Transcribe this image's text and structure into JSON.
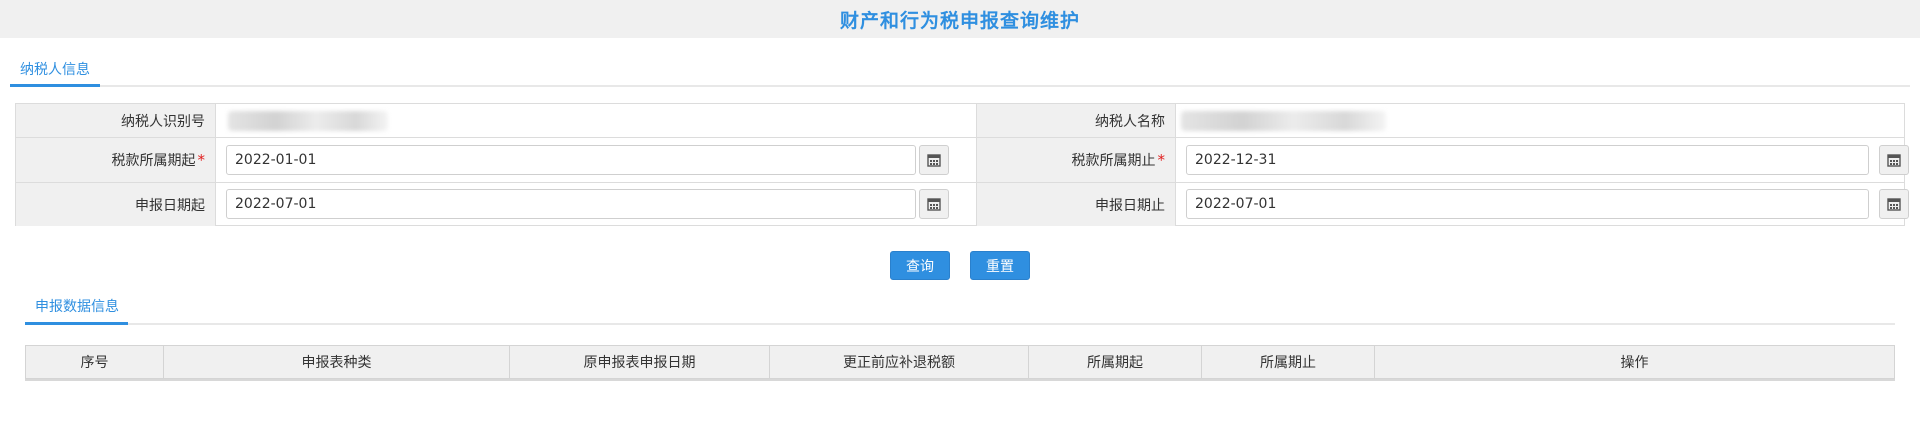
{
  "page": {
    "title": "财产和行为税申报查询维护"
  },
  "taxpayer_section": {
    "tab_label": "纳税人信息"
  },
  "form": {
    "taxpayer_id_label": "纳税人识别号",
    "taxpayer_name_label": "纳税人名称",
    "period_start_label": "税款所属期起",
    "period_start_value": "2022-01-01",
    "period_end_label": "税款所属期止",
    "period_end_value": "2022-12-31",
    "declare_start_label": "申报日期起",
    "declare_start_value": "2022-07-01",
    "declare_end_label": "申报日期止",
    "declare_end_value": "2022-07-01",
    "required_mark": "*"
  },
  "actions": {
    "query_label": "查询",
    "reset_label": "重置"
  },
  "data_section": {
    "tab_label": "申报数据信息"
  },
  "table": {
    "headers": [
      "序号",
      "申报表种类",
      "原申报表申报日期",
      "更正前应补退税额",
      "所属期起",
      "所属期止",
      "操作"
    ],
    "rows": []
  },
  "colors": {
    "accent": "#2f8fe0",
    "required": "#e02020",
    "label_bg": "#f0f0f0"
  },
  "icons": {
    "calendar": "calendar-icon"
  }
}
